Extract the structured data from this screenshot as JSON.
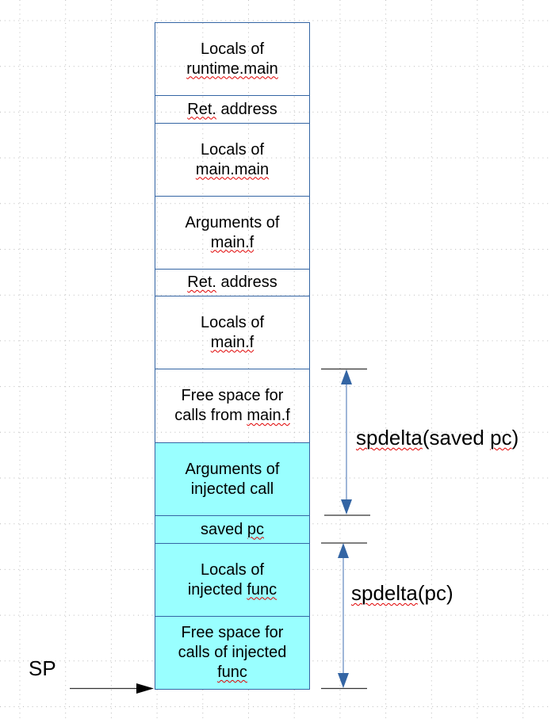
{
  "colors": {
    "border": "#3465a4",
    "injected_fill": "#99ffff",
    "arrow_line": "#9fb6d8",
    "arrow_head": "#3465a4",
    "spellcheck": "#e00000"
  },
  "stack": [
    {
      "lines": [
        [
          {
            "t": "Locals of"
          }
        ],
        [
          {
            "t": "runtime.main",
            "sq": true
          }
        ]
      ],
      "injected": false
    },
    {
      "lines": [
        [
          {
            "t": "Ret.",
            "sq": true
          },
          {
            "t": " address"
          }
        ]
      ],
      "injected": false
    },
    {
      "lines": [
        [
          {
            "t": "Locals of"
          }
        ],
        [
          {
            "t": "main.main",
            "sq": true
          }
        ]
      ],
      "injected": false
    },
    {
      "lines": [
        [
          {
            "t": "Arguments of"
          }
        ],
        [
          {
            "t": "main.f",
            "sq": true
          }
        ]
      ],
      "injected": false
    },
    {
      "lines": [
        [
          {
            "t": "Ret.",
            "sq": true
          },
          {
            "t": " address"
          }
        ]
      ],
      "injected": false
    },
    {
      "lines": [
        [
          {
            "t": "Locals of"
          }
        ],
        [
          {
            "t": "main.f",
            "sq": true
          }
        ]
      ],
      "injected": false
    },
    {
      "lines": [
        [
          {
            "t": "Free space for"
          }
        ],
        [
          {
            "t": "calls from "
          },
          {
            "t": "main.f",
            "sq": true
          }
        ]
      ],
      "injected": false
    },
    {
      "lines": [
        [
          {
            "t": "Arguments of"
          }
        ],
        [
          {
            "t": "injected call"
          }
        ]
      ],
      "injected": true
    },
    {
      "lines": [
        [
          {
            "t": "saved "
          },
          {
            "t": "pc",
            "sq": true
          }
        ]
      ],
      "injected": true
    },
    {
      "lines": [
        [
          {
            "t": "Locals of"
          }
        ],
        [
          {
            "t": "injected "
          },
          {
            "t": "func",
            "sq": true
          }
        ]
      ],
      "injected": true
    },
    {
      "lines": [
        [
          {
            "t": "Free space for"
          }
        ],
        [
          {
            "t": "calls of injected"
          }
        ],
        [
          {
            "t": "func",
            "sq": true
          }
        ]
      ],
      "injected": true
    }
  ],
  "labels": {
    "spdelta_saved": [
      {
        "t": "spdelta",
        "sq": true
      },
      {
        "t": "(saved "
      },
      {
        "t": "pc",
        "sq": true
      },
      {
        "t": ")"
      }
    ],
    "spdelta_pc": [
      {
        "t": "spdelta",
        "sq": true
      },
      {
        "t": "(pc)"
      }
    ],
    "sp": "SP"
  }
}
